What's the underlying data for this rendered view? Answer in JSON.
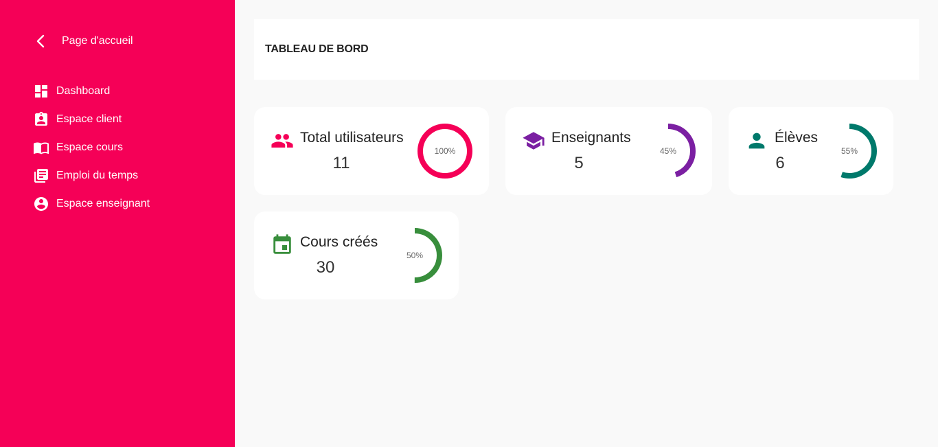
{
  "sidebar": {
    "back_label": "Page d'accueil",
    "items": [
      {
        "label": "Dashboard",
        "icon": "dashboard-icon"
      },
      {
        "label": "Espace client",
        "icon": "badge-icon"
      },
      {
        "label": "Espace cours",
        "icon": "book-icon"
      },
      {
        "label": "Emploi du temps",
        "icon": "library-books-icon"
      },
      {
        "label": "Espace enseignant",
        "icon": "account-circle-icon"
      }
    ]
  },
  "header": {
    "title": "TABLEAU DE BORD"
  },
  "stats": [
    {
      "title": "Total utilisateurs",
      "value": "11",
      "percent_label": "100%",
      "percent": 100,
      "color": "#f50057",
      "icon": "group-icon"
    },
    {
      "title": "Enseignants",
      "value": "5",
      "percent_label": "45%",
      "percent": 45,
      "color": "#7b1fa2",
      "icon": "school-icon"
    },
    {
      "title": "Élèves",
      "value": "6",
      "percent_label": "55%",
      "percent": 55,
      "color": "#00796b",
      "icon": "person-icon"
    },
    {
      "title": "Cours créés",
      "value": "30",
      "percent_label": "50%",
      "percent": 50,
      "color": "#388e3c",
      "icon": "calendar-icon"
    }
  ],
  "colors": {
    "sidebar": "#f50057",
    "background": "#f9f9f9",
    "card": "#ffffff"
  }
}
